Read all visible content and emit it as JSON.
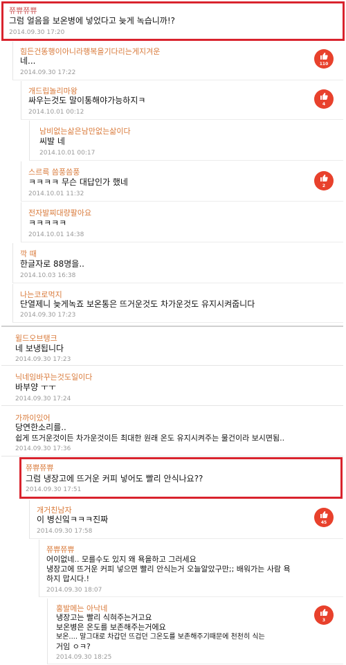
{
  "comments": [
    {
      "author": "쮸쀼쮸쀼",
      "lines": [
        "그럼 얼음을 보온병에 넣었다고 늦게 녹습니까!?"
      ],
      "date": "2014.09.30 17:20"
    },
    {
      "author": "힘든건똥행이아니라행복을기다리는게지겨운",
      "lines": [
        "네..."
      ],
      "date": "2014.09.30 17:22",
      "likes": "110"
    },
    {
      "author": "개드립놀리마왕",
      "lines": [
        "싸우는것도 말이통해야가능하지ㅋ"
      ],
      "date": "2014.10.01 00:12",
      "likes": "4"
    },
    {
      "author": "남비없는삶은남만없는삶이다",
      "lines": [
        "씨발 네"
      ],
      "date": "2014.10.01 00:17"
    },
    {
      "author": "스르륵 씀풍씀풍",
      "lines": [
        "ㅋㅋㅋㅋ 무슨 대답인가 했네"
      ],
      "date": "2014.10.01 11:32",
      "likes": "2"
    },
    {
      "author": "전자발찌대량팔아요",
      "lines": [
        "ㅋㅋㅋㅋㅋ"
      ],
      "date": "2014.10.01 14:38"
    },
    {
      "author": "깍 때",
      "lines": [
        "한글자로 88명을.."
      ],
      "date": "2014.10.03 16:38"
    },
    {
      "author": "나는코로먹지",
      "lines": [
        "단열제니 늦게녹죠 보온통은 뜨거운것도 차가운것도 유지시켜줍니다"
      ],
      "date": "2014.09.30 17:23"
    },
    {
      "author": "윌드오브탱크",
      "lines": [
        "네 보냉됩니다"
      ],
      "date": "2014.09.30 17:23"
    },
    {
      "author": "닉네임바꾸는것도일이다",
      "lines": [
        "바부양 ㅜㅜ"
      ],
      "date": "2014.09.30 17:24"
    },
    {
      "author": "가까이있어",
      "lines": [
        "당연한소리를..",
        "쉽게 뜨거운것이든 차가운것이든 최대한 원래 온도 유지시켜주는 물건이라 보시면됨.."
      ],
      "date": "2014.09.30 17:36"
    },
    {
      "author": "쮸쀼쮸쀼",
      "lines": [
        "그럼 냉장고에 뜨거운 커피 넣어도 빨리 안식나요??"
      ],
      "date": "2014.09.30 17:51"
    },
    {
      "author": "개거친남자",
      "lines": [
        "이 병신잌ㅋㅋㅋ진짜"
      ],
      "date": "2014.09.30 17:58",
      "likes": "45"
    },
    {
      "author": "쮸쀼쮸쀼",
      "lines": [
        "어이없네.. 모를수도 있지 왜 욕을하고 그러세요",
        "냉장고에 뜨거운 커피 넣으면 빨리 안식는거 오늘알았구만;; 배워가는 사람 욕",
        "하지 맙시다.!"
      ],
      "date": "2014.09.30 18:07"
    },
    {
      "author": "홍발메는 아낙네",
      "lines": [
        "냉장고는 빨리 식혀주는거고요",
        "보온병은 온도를 보존해주는거에요",
        "보온.... 말그대로 차갑던 뜨겁던 그온도를 보존해주기때문에 천천히 식는",
        "거임 ㅇㅋ?"
      ],
      "date": "2014.09.30 18:25",
      "likes": "3"
    }
  ],
  "colors": {
    "accent": "#d9232d",
    "author": "#d97a3a",
    "like_badge": "#e8412c"
  },
  "icons": {
    "like": "thumbs-up-icon"
  }
}
